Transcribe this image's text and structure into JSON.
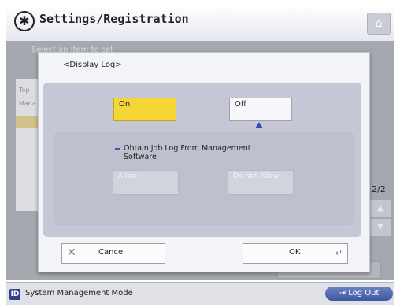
{
  "header": {
    "title": "Settings/Registration",
    "icon": "gear-icon",
    "home_icon": "home-icon"
  },
  "background": {
    "subtitle": "Select an item to set",
    "list_items": [
      "Top",
      "Mana"
    ],
    "page_indicator": "2/2",
    "scroll_up": "▲",
    "scroll_down": "▼"
  },
  "dialog": {
    "title": "<Display Log>",
    "on_label": "On",
    "off_label": "Off",
    "selected": "On",
    "sub_setting": {
      "label": "Obtain Job Log From Management Software",
      "allow_label": "Allow",
      "not_allow_label": "Do Not Allow"
    },
    "cancel_label": "Cancel",
    "ok_label": "OK"
  },
  "status": {
    "mode_icon": "ID",
    "mode_text": "System Management Mode",
    "logout_label": "Log Out"
  },
  "colors": {
    "selected_yellow": "#f5d637",
    "accent_blue": "#3e57a0"
  }
}
